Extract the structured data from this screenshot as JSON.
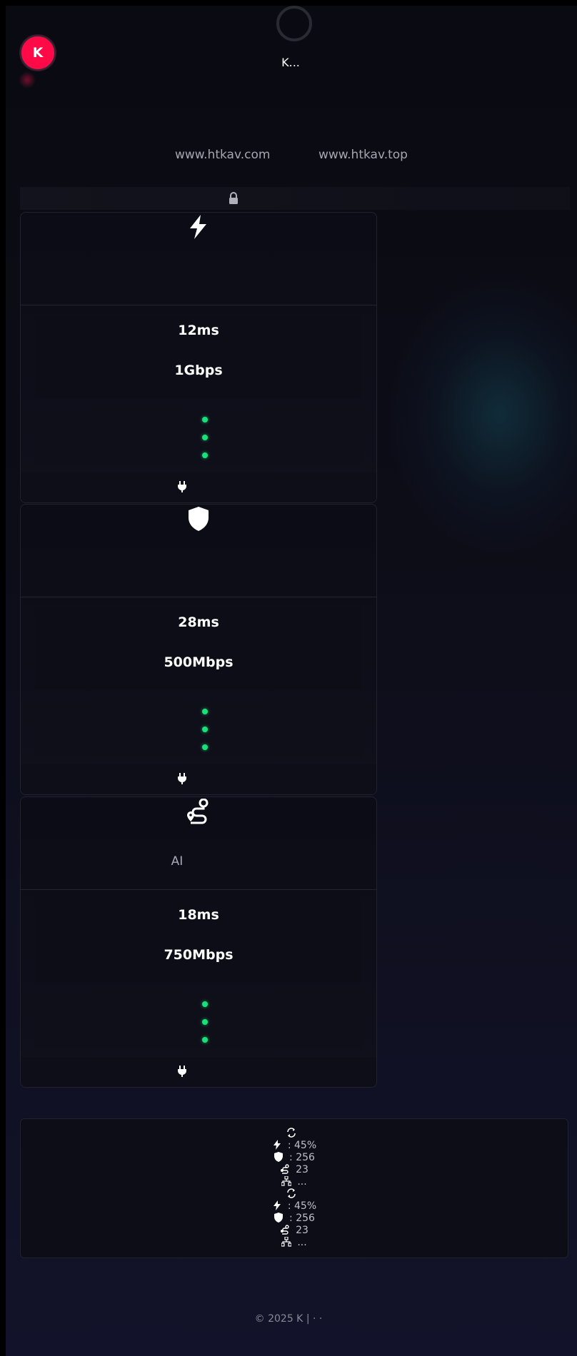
{
  "loader": {
    "text": "K..."
  },
  "brand": {
    "logo_letter": "K",
    "logo_color": "#ff0a47"
  },
  "domains": [
    "www.htkav.com",
    "www.htkav.top"
  ],
  "accent_status_color": "#16e27a",
  "cards": [
    {
      "icon": "lightning-icon",
      "subtitle": "",
      "latency": "12ms",
      "bandwidth": "1Gbps",
      "footer_icon": "plug-icon"
    },
    {
      "icon": "shield-icon",
      "subtitle": "",
      "latency": "28ms",
      "bandwidth": "500Mbps",
      "footer_icon": "plug-icon"
    },
    {
      "icon": "route-icon",
      "subtitle": "AI",
      "latency": "18ms",
      "bandwidth": "750Mbps",
      "footer_icon": "plug-icon"
    }
  ],
  "stats": {
    "items": [
      {
        "icon": "refresh-icon",
        "text": ""
      },
      {
        "icon": "lightning-icon",
        "text": ": 45%"
      },
      {
        "icon": "shield-icon",
        "text": ": 256"
      },
      {
        "icon": "route-icon",
        "text": "23"
      },
      {
        "icon": "network-icon",
        "text": "..."
      },
      {
        "icon": "refresh-icon",
        "text": ""
      },
      {
        "icon": "lightning-icon",
        "text": ": 45%"
      },
      {
        "icon": "shield-icon",
        "text": ": 256"
      },
      {
        "icon": "route-icon",
        "text": "23"
      },
      {
        "icon": "network-icon",
        "text": "..."
      }
    ]
  },
  "footer": {
    "text": "© 2025 K |  ·  ·"
  }
}
